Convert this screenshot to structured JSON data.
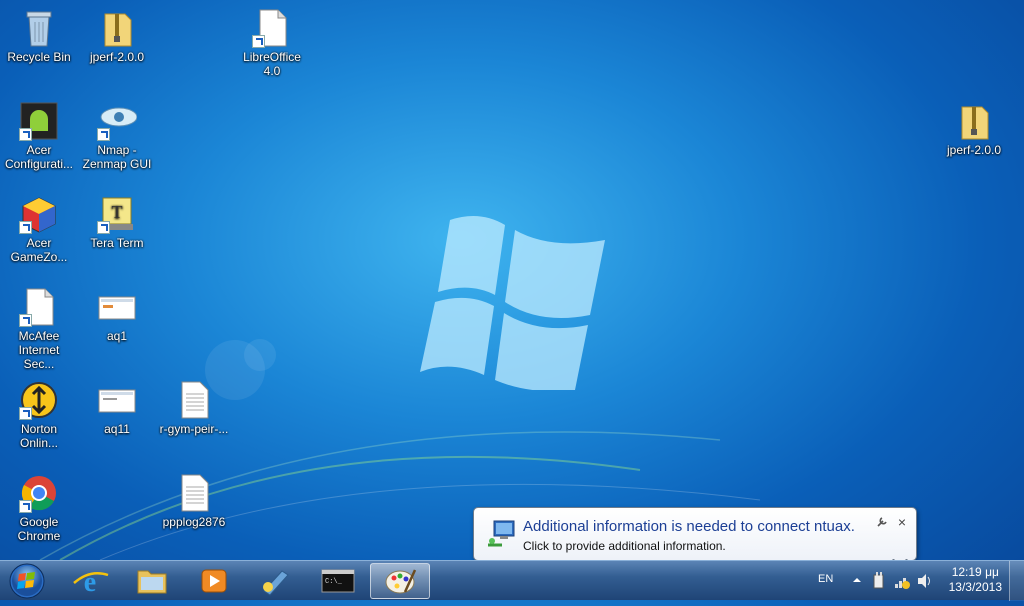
{
  "desktop": {
    "icons": [
      {
        "label": "Recycle Bin"
      },
      {
        "label": "jperf-2.0.0"
      },
      {
        "label": "LibreOffice 4.0"
      },
      {
        "label": "Acer Configurati..."
      },
      {
        "label": "Nmap - Zenmap GUI"
      },
      {
        "label": "Acer GameZo..."
      },
      {
        "label": "Tera Term"
      },
      {
        "label": "McAfee Internet Sec..."
      },
      {
        "label": "aq1"
      },
      {
        "label": "Norton Onlin..."
      },
      {
        "label": "aq11"
      },
      {
        "label": "r-gym-peir-..."
      },
      {
        "label": "Google Chrome"
      },
      {
        "label": "ppplog2876"
      },
      {
        "label": "jperf-2.0.0"
      }
    ]
  },
  "balloon": {
    "title": "Additional information is needed to connect ntuax.",
    "body": "Click to provide additional information.",
    "close": "×"
  },
  "tray": {
    "language": "EN",
    "time": "12:19 μμ",
    "date": "13/3/2013"
  },
  "colors": {
    "desktop_blue": "#1b86d6",
    "taskbar": "#335e92",
    "balloon_title": "#1c3f95"
  }
}
